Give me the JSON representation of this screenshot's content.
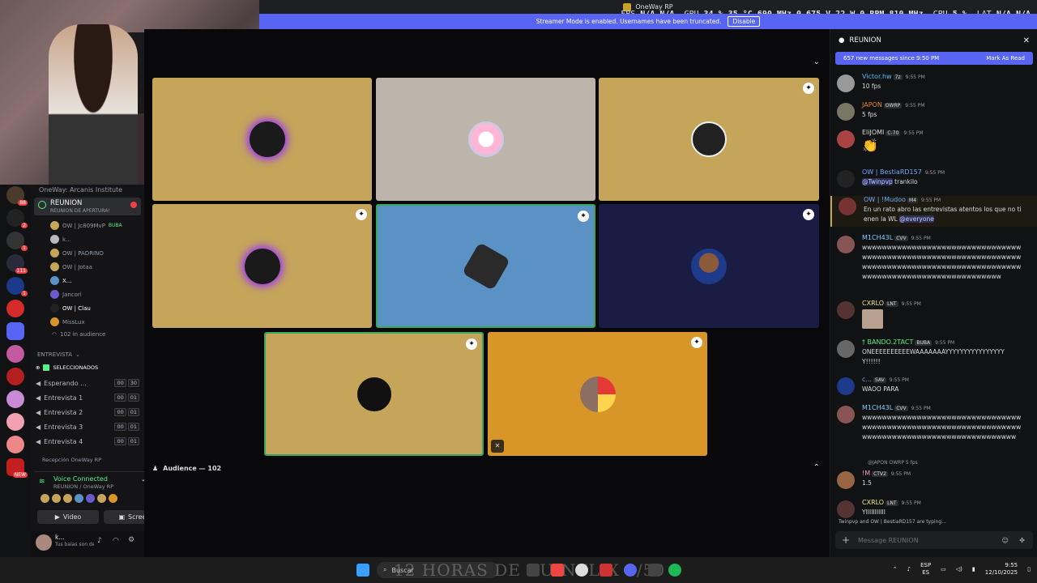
{
  "window": {
    "title": "OneWay RP",
    "perf": {
      "fps_label": "FPS",
      "fps": "N/A",
      "fps2": "N/A",
      "gpu_label": "GPU",
      "gpu_pct": "34 %",
      "gpu_temp": "35 °C",
      "gpu_clock": "690 MHz",
      "gpu_v": "0.675 V",
      "gpu_w": "22 W",
      "gpu_rpm": "0 RPM",
      "gpu_mem": "810 MHz",
      "cpu_label": "CPU",
      "cpu_pct": "5 %",
      "lat_label": "LAT",
      "lat": "N/A",
      "lat2": "N/A"
    }
  },
  "streamer_banner": {
    "text": "Streamer Mode is enabled. Usernames have been truncated.",
    "button": "Disable"
  },
  "sidebar": {
    "server_name": "OneWay: Arcanis Institute",
    "active_channel": {
      "name": "REUNION",
      "subtitle": "REUNION DE APERTURA!"
    },
    "members": [
      "OW | Jc809MvP",
      "k...",
      "OW | PADRINO",
      "OW | Jotaa",
      "X...",
      "Jancori",
      "OW | Clau",
      "MissLux"
    ],
    "member_tags": {
      "buba": "BUBA"
    },
    "audience_count": "102 in audience",
    "category": "ENTREVISTA",
    "channels": [
      {
        "name": "SELECCIONADOS",
        "a": "",
        "b": ""
      },
      {
        "name": "Esperando ...",
        "a": "00",
        "b": "30"
      },
      {
        "name": "Entrevista 1",
        "a": "00",
        "b": "01"
      },
      {
        "name": "Entrevista 2",
        "a": "00",
        "b": "01"
      },
      {
        "name": "Entrevista 3",
        "a": "00",
        "b": "01"
      },
      {
        "name": "Entrevista 4",
        "a": "00",
        "b": "01"
      }
    ],
    "next_category": "Recepción OneWay RP",
    "rail_badges": [
      "88",
      "2",
      "1",
      "111",
      "1",
      "NEW"
    ]
  },
  "voice": {
    "status": "Voice Connected",
    "location": "REUNION",
    "server": "OneWay RP",
    "video": "Video",
    "screen": "Screen"
  },
  "user": {
    "name": "k...",
    "status": "Tus balas son de..."
  },
  "stage": {
    "audience_label": "Audience — 102",
    "tiles": [
      {
        "bg": "#c4a55a"
      },
      {
        "bg": "#bdb5ab"
      },
      {
        "bg": "#c4a55a"
      },
      {
        "bg": "#c4a55a"
      },
      {
        "bg": "#5b92c6"
      },
      {
        "bg": "#1a1c44"
      },
      {
        "bg": "#c4a55a"
      },
      {
        "bg": "#d89528"
      }
    ]
  },
  "chat": {
    "channel": "REUNION",
    "new_messages": "657 new messages since 9:50 PM",
    "mark_read": "Mark As Read",
    "messages": [
      {
        "name": "Victor.hw",
        "tag": "7z",
        "time": "9:55 PM",
        "text": "10 fps",
        "color": "#4fc3f7"
      },
      {
        "name": "JAPON",
        "tag": "OWRP",
        "time": "9:55 PM",
        "text": "5 fps",
        "color": "#e8823a"
      },
      {
        "name": "EliJOMI",
        "tag": "C-70",
        "time": "9:55 PM",
        "text": "👏",
        "color": "#dbdee1"
      },
      {
        "name": "OW | BestiaRD157",
        "tag": "",
        "time": "9:55 PM",
        "text_mention": "@Twinpvp",
        "text": " trankilo",
        "color": "#6ea8fe"
      },
      {
        "name": "OW | !Mudoo",
        "tag": "M4",
        "time": "9:55 PM",
        "text": "En un rato abro las entrevistas atentos los que no tienen la WL ",
        "text_mention2": "@everyone",
        "color": "#6ea8fe"
      },
      {
        "name": "M1CH43L",
        "tag": "CVV",
        "time": "9:55 PM",
        "text": "wwwwwwwwwwwwwwwwwwwwwwwwwwwwwwwwwwwwwwwwwwwwwwwwwwwwwwwwwwwwwwwwwwwwwwwwwwwwwwwwwwwwwwwwwwwwwwwwwwwwwwwwwwwwwwwwwwwwwwwwwwww",
        "color": "#7fd1ff"
      },
      {
        "name": "CXRLO",
        "tag": "LNT",
        "time": "9:55 PM",
        "text": "",
        "color": "#f0e68c"
      },
      {
        "name": "† BANDO.2TACT",
        "tag": "BUBA",
        "time": "9:55 PM",
        "text": "ONEEEEEEEEEEWAAAAAAAYYYYYYYYYYYYYYYYY!!!!!!",
        "color": "#57f287"
      },
      {
        "name": "c...",
        "tag": "SAV",
        "time": "9:55 PM",
        "text": "WAOO PARA",
        "color": "#6ea8fe"
      },
      {
        "name": "M1CH43L",
        "tag": "CVV",
        "time": "9:55 PM",
        "text": "wwwwwwwwwwwwwwwwwwwwwwwwwwwwwwwwwwwwwwwwwwwwwwwwwwwwwwwwwwwwwwwwwwwwwwwwwwwwwwwwwwwwwwwwwwwwwww",
        "color": "#7fd1ff"
      },
      {
        "name": "!M",
        "tag": "CTV2",
        "time": "9:55 PM",
        "text": "1.5",
        "color": "#f0a0c0"
      },
      {
        "name": "CXRLO",
        "tag": "LNT",
        "time": "9:55 PM",
        "text": "YIIIIIIIIIII",
        "color": "#f0e68c"
      }
    ],
    "reply_preview": "@JAPON  OWRP 5 fps",
    "typing": "Twinpvp and OW | BestiaRD157 are typing...",
    "placeholder": "Message  REUNION"
  },
  "taskbar": {
    "search": "Buscar",
    "overlay": "12 HORAS DE RUINFLIX 2/50",
    "lang1": "ESP",
    "lang2": "ES",
    "time": "9:55",
    "date": "12/10/2025"
  }
}
